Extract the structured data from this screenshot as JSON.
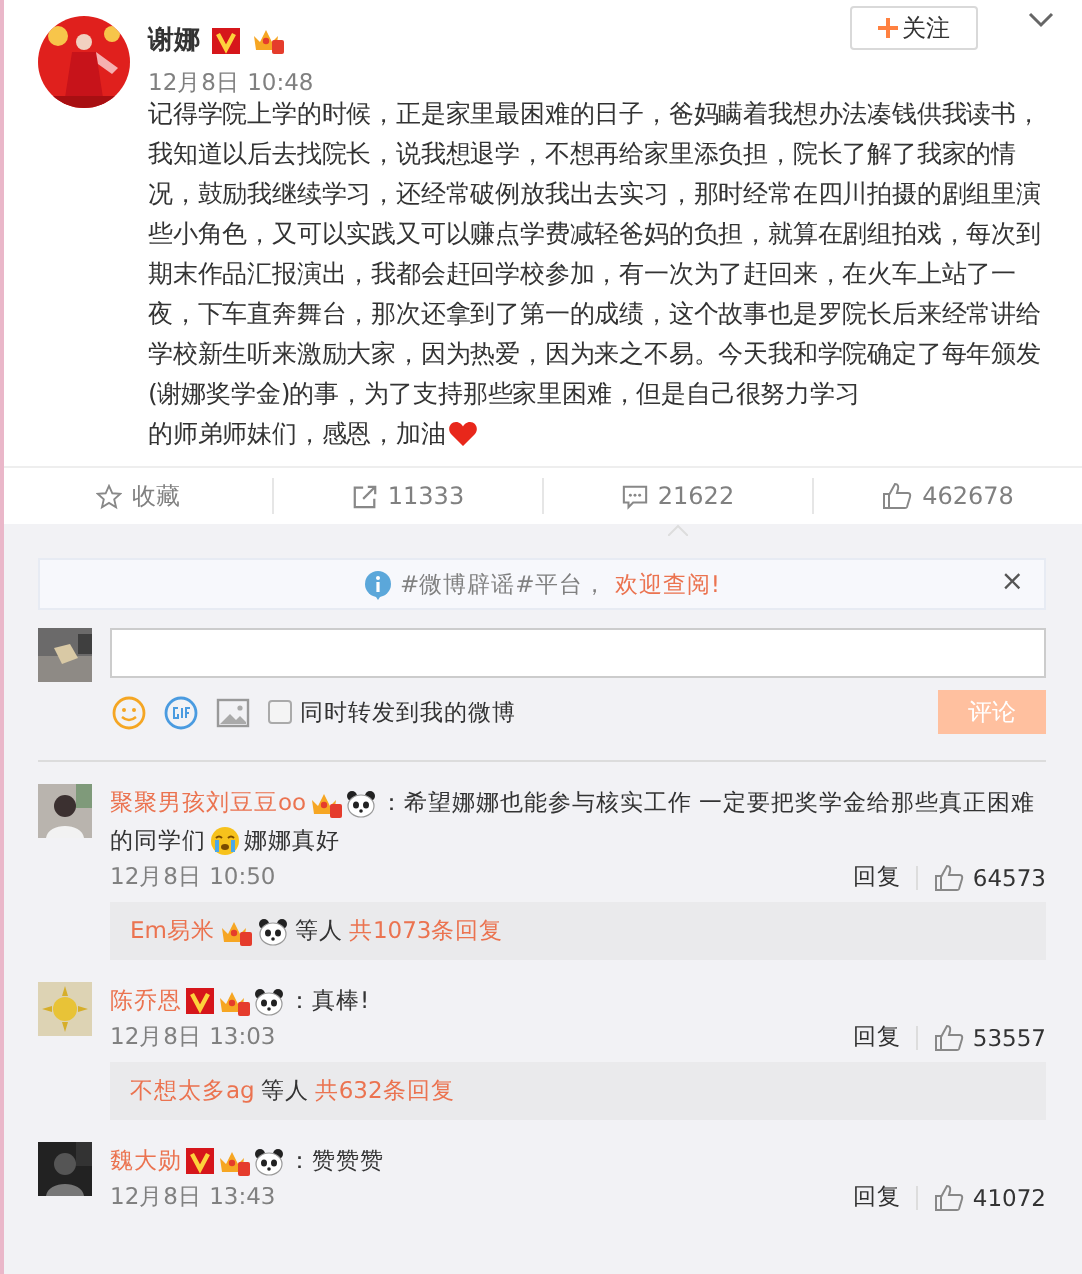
{
  "post": {
    "author": "谢娜",
    "verified": true,
    "time": "12月8日 10:48",
    "follow": "关注",
    "body": "记得学院上学的时候，正是家里最困难的日子，爸妈瞒着我想办法凑钱供我读书，我知道以后去找院长，说我想退学，不想再给家里添负担，院长了解了我家的情况，鼓励我继续学习，还经常破例放我出去实习，那时经常在四川拍摄的剧组里演些小角色，又可以实践又可以赚点学费减轻爸妈的负担，就算在剧组拍戏，每次到期末作品汇报演出，我都会赶回学校参加，有一次为了赶回来，在火车上站了一夜，下车直奔舞台，那次还拿到了第一的成绩，这个故事也是罗院长后来经常讲给学校新生听来激励大家，因为热爱，因为来之不易。今天我和学院确定了每年颁发(谢娜奖学金)的事，为了支持那些家里困难，但是自己很努力学习",
    "body_end": "的师弟师妹们，感恩，加油"
  },
  "actions": [
    {
      "kind": "favorite",
      "label": "收藏"
    },
    {
      "kind": "repost",
      "label": "11333"
    },
    {
      "kind": "comment",
      "label": "21622"
    },
    {
      "kind": "like",
      "label": "462678"
    }
  ],
  "notice": {
    "text": "#微博辟谣#平台，",
    "link": "欢迎查阅!",
    "close": "×"
  },
  "composer": {
    "repost_label": "同时转发到我的微博",
    "repost_checked": false,
    "submit": "评论",
    "submit_disabled": true
  },
  "comments": [
    {
      "name": "聚聚男孩刘豆豆oo",
      "verified": false,
      "text": "：希望娜娜也能参与核实工作 一定要把奖学金给那些真正困难",
      "continuation": [
        {
          "kind": "text",
          "text": "的同学们"
        },
        {
          "kind": "crying-emoji"
        },
        {
          "kind": "text",
          "text": "娜娜真好"
        }
      ],
      "time": "12月8日 10:50",
      "reply": "回复",
      "likes": "64573",
      "replies": {
        "names": "Em易米",
        "badges": true,
        "others": "等人",
        "count": "共1073条回复"
      }
    },
    {
      "name": "陈乔恩",
      "verified": true,
      "text": "：真棒!",
      "time": "12月8日 13:03",
      "reply": "回复",
      "likes": "53557",
      "replies": {
        "names": "不想太多ag",
        "badges": false,
        "others": "等人",
        "count": "共632条回复"
      }
    },
    {
      "name": "魏大勋",
      "verified": true,
      "text": "：赞赞赞",
      "time": "12月8日 13:43",
      "reply": "回复",
      "likes": "41072"
    }
  ]
}
